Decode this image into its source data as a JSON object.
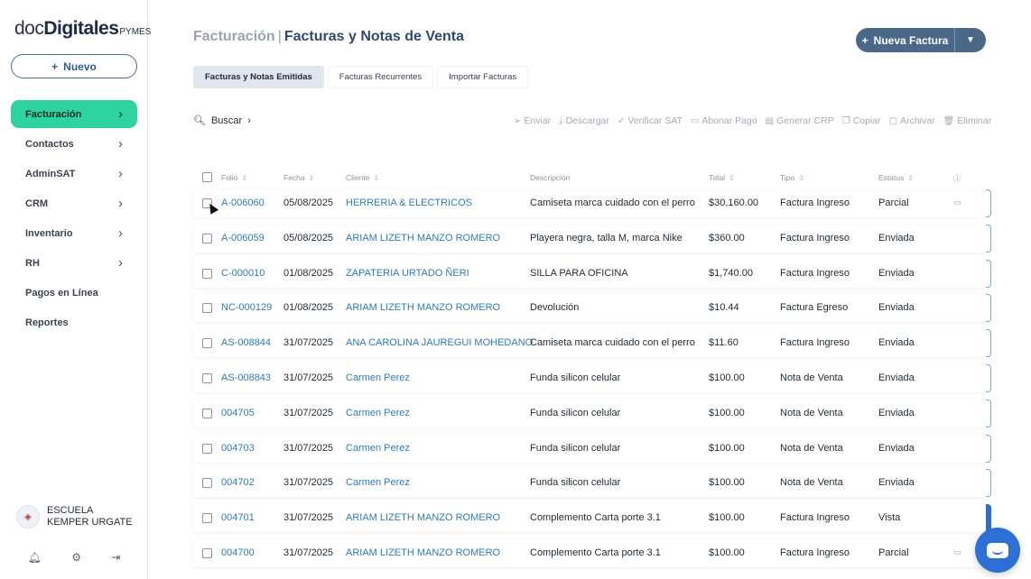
{
  "brand": {
    "logo_part1": "doc",
    "logo_part2": "Digitales",
    "logo_suffix": "PYMES"
  },
  "sidebar": {
    "new_button": "Nuevo",
    "items": [
      {
        "label": "Facturación",
        "chevron": true,
        "active": true
      },
      {
        "label": "Contactos",
        "chevron": true
      },
      {
        "label": "AdminSAT",
        "chevron": true
      },
      {
        "label": "CRM",
        "chevron": true
      },
      {
        "label": "Inventario",
        "chevron": true
      },
      {
        "label": "RH",
        "chevron": true
      },
      {
        "label": "Pagos en Línea",
        "chevron": false
      },
      {
        "label": "Reportes",
        "chevron": false
      }
    ],
    "org_name": "ESCUELA KEMPER URGATE",
    "bottom_icons": [
      "bell-icon",
      "gear-icon",
      "logout-icon"
    ]
  },
  "header": {
    "breadcrumb": "Facturación",
    "separator": "|",
    "title": "Facturas y Notas de Venta",
    "new_invoice_button": "Nueva Factura"
  },
  "tabs": [
    {
      "label": "Facturas y Notas Emitidas",
      "active": true
    },
    {
      "label": "Facturas Recurrentes"
    },
    {
      "label": "Importar Facturas"
    }
  ],
  "search_label": "Buscar",
  "toolbar": [
    "Enviar",
    "Descargar",
    "Verificar SAT",
    "Abonar Pago",
    "Generar CRP",
    "Copiar",
    "Archivar",
    "Eliminar"
  ],
  "table": {
    "columns": [
      "Folio",
      "Fecha",
      "Cliente",
      "Descripción",
      "Total",
      "Tipo",
      "Estatus"
    ],
    "rows": [
      {
        "folio": "A-006060",
        "fecha": "05/08/2025",
        "cliente": "HERRERIA & ELECTRICOS",
        "descripcion": "Camiseta marca cuidado con el perro",
        "total": "$30,160.00",
        "tipo": "Factura Ingreso",
        "estatus": "Parcial"
      },
      {
        "folio": "A-006059",
        "fecha": "05/08/2025",
        "cliente": "ARIAM LIZETH MANZO ROMERO",
        "descripcion": "Playera negra, talla M, marca Nike",
        "total": "$360.00",
        "tipo": "Factura Ingreso",
        "estatus": "Enviada"
      },
      {
        "folio": "C-000010",
        "fecha": "01/08/2025",
        "cliente": "ZAPATERIA URTADO ÑERI",
        "descripcion": "SILLA PARA OFICINA",
        "total": "$1,740.00",
        "tipo": "Factura Ingreso",
        "estatus": "Enviada"
      },
      {
        "folio": "NC-000129",
        "fecha": "01/08/2025",
        "cliente": "ARIAM LIZETH MANZO ROMERO",
        "descripcion": "Devolución",
        "total": "$10.44",
        "tipo": "Factura Egreso",
        "estatus": "Enviada"
      },
      {
        "folio": "AS-008844",
        "fecha": "31/07/2025",
        "cliente": "ANA CAROLINA JAUREGUI MOHEDANO",
        "descripcion": "Camiseta marca cuidado con el perro",
        "total": "$11.60",
        "tipo": "Factura Ingreso",
        "estatus": "Enviada"
      },
      {
        "folio": "AS-008843",
        "fecha": "31/07/2025",
        "cliente": "Carmen Perez",
        "descripcion": "Funda silicon celular",
        "total": "$100.00",
        "tipo": "Nota de Venta",
        "estatus": "Enviada"
      },
      {
        "folio": "004705",
        "fecha": "31/07/2025",
        "cliente": "Carmen Perez",
        "descripcion": "Funda silicon celular",
        "total": "$100.00",
        "tipo": "Nota de Venta",
        "estatus": "Enviada"
      },
      {
        "folio": "004703",
        "fecha": "31/07/2025",
        "cliente": "Carmen Perez",
        "descripcion": "Funda silicon celular",
        "total": "$100.00",
        "tipo": "Nota de Venta",
        "estatus": "Enviada"
      },
      {
        "folio": "004702",
        "fecha": "31/07/2025",
        "cliente": "Carmen Perez",
        "descripcion": "Funda silicon celular",
        "total": "$100.00",
        "tipo": "Nota de Venta",
        "estatus": "Enviada"
      },
      {
        "folio": "004701",
        "fecha": "31/07/2025",
        "cliente": "ARIAM LIZETH MANZO ROMERO",
        "descripcion": "Complemento Carta porte 3.1",
        "total": "$100.00",
        "tipo": "Factura Ingreso",
        "estatus": "Vista"
      },
      {
        "folio": "004700",
        "fecha": "31/07/2025",
        "cliente": "ARIAM LIZETH MANZO ROMERO",
        "descripcion": "Complemento Carta porte 3.1",
        "total": "$100.00",
        "tipo": "Factura Ingreso",
        "estatus": "Parcial"
      }
    ]
  }
}
